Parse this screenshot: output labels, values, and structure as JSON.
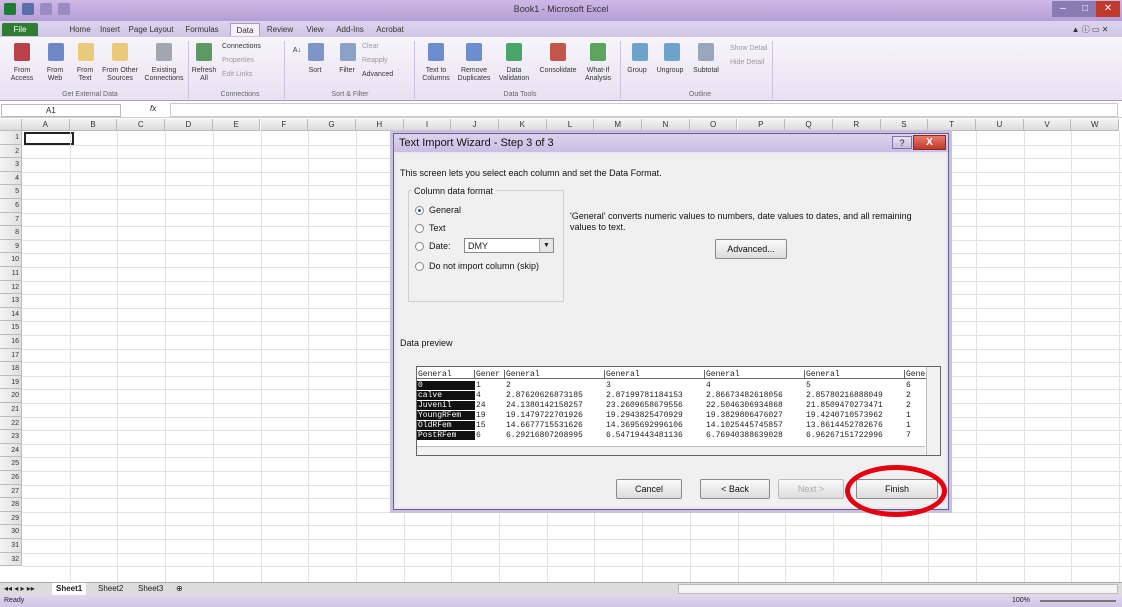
{
  "app": {
    "title": "Book1 - Microsoft Excel"
  },
  "tabs": [
    "File",
    "Home",
    "Insert",
    "Page Layout",
    "Formulas",
    "Data",
    "Review",
    "View",
    "Add-Ins",
    "Acrobat"
  ],
  "ribbon": {
    "groups": {
      "external": "Get External Data",
      "connections": "Connections",
      "sort": "Sort & Filter",
      "tools": "Data Tools",
      "outline": "Outline"
    },
    "buttons": {
      "access": "From Access",
      "web": "From Web",
      "text": "From Text",
      "other": "From Other Sources",
      "existing": "Existing Connections",
      "refresh": "Refresh All",
      "conns": "Connections",
      "props": "Properties",
      "links": "Edit Links",
      "sortaz": "A↓",
      "sort": "Sort",
      "filter": "Filter",
      "clear": "Clear",
      "reapply": "Reapply",
      "advanced": "Advanced",
      "t2c": "Text to Columns",
      "dup": "Remove Duplicates",
      "valid": "Data Validation",
      "consol": "Consolidate",
      "whatif": "What-If Analysis",
      "group": "Group",
      "ungroup": "Ungroup",
      "subtotal": "Subtotal",
      "show": "Show Detail",
      "hide": "Hide Detail"
    }
  },
  "formula": {
    "namebox": "A1",
    "fx": "fx"
  },
  "columns": [
    "A",
    "B",
    "C",
    "D",
    "E",
    "F",
    "G",
    "H",
    "I",
    "J",
    "K",
    "L",
    "M",
    "N",
    "O",
    "P",
    "Q",
    "R",
    "S",
    "T",
    "U",
    "V",
    "W"
  ],
  "rows": [
    "1",
    "2",
    "3",
    "4",
    "5",
    "6",
    "7",
    "8",
    "9",
    "10",
    "11",
    "12",
    "13",
    "14",
    "15",
    "16",
    "17",
    "18",
    "19",
    "20",
    "21",
    "22",
    "23",
    "24",
    "25",
    "26",
    "27",
    "28",
    "29",
    "30",
    "31",
    "32"
  ],
  "sheets": [
    "Sheet1",
    "Sheet2",
    "Sheet3"
  ],
  "status": {
    "left": "Ready",
    "zoom": "100%"
  },
  "dialog": {
    "title": "Text Import Wizard - Step 3 of 3",
    "help": "?",
    "close": "X",
    "intro": "This screen lets you select each column and set the Data Format.",
    "group_label": "Column data format",
    "radio_general": "General",
    "radio_text": "Text",
    "radio_date": "Date:",
    "date_value": "DMY",
    "radio_skip": "Do not import column (skip)",
    "explain": "'General' converts numeric values to numbers, date values to dates, and all remaining values to text.",
    "advanced": "Advanced...",
    "preview_label": "Data preview",
    "headers": [
      "General",
      "Gener",
      "General",
      "General",
      "General",
      "General",
      "Genera"
    ],
    "rows": [
      [
        "0",
        "1",
        "2",
        "3",
        "4",
        "5",
        "6"
      ],
      [
        "calve",
        "4",
        "2.87620626873185",
        "2.87199781184153",
        "2.86673482618056",
        "2.85780216888049",
        "2"
      ],
      [
        "Juvenil",
        "24",
        "24.1380142158257",
        "23.2609658679556",
        "22.5046306934868",
        "21.8509470273471",
        "2"
      ],
      [
        "YoungRFem",
        "19",
        "19.1479722701926",
        "19.2943825470929",
        "19.3829806476027",
        "19.4240710573962",
        "1"
      ],
      [
        "OldRFem",
        "15",
        "14.6677715531626",
        "14.3695692996106",
        "14.1025445745857",
        "13.8614452782676",
        "1"
      ],
      [
        "PostRFem",
        "6",
        "6.29216807208995",
        "6.54719443481136",
        "6.76940388639028",
        "6.96267151722996",
        "7"
      ]
    ],
    "cancel": "Cancel",
    "back": "< Back",
    "next": "Next >",
    "finish": "Finish"
  }
}
